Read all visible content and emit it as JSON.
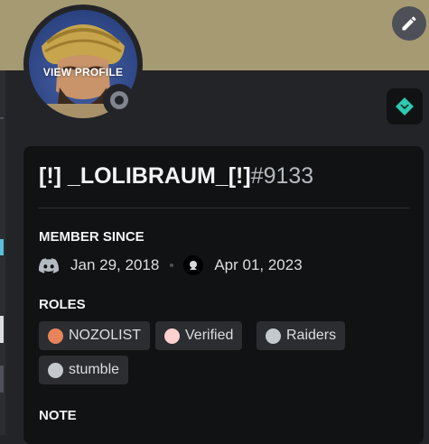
{
  "profile": {
    "avatar_overlay_label": "VIEW PROFILE",
    "username": "[!] _LOLIBRAUM_[!]",
    "discriminator": "#9133",
    "status": "offline"
  },
  "member_since": {
    "title": "MEMBER SINCE",
    "discord_date": "Jan 29, 2018",
    "server_date": "Apr 01, 2023"
  },
  "roles": {
    "title": "ROLES",
    "items": [
      {
        "name": "NOZOLIST",
        "color": "#e8845c"
      },
      {
        "name": "Verified",
        "color": "#ffd0d0"
      },
      {
        "name": "Raiders",
        "color": "#c4c9ce"
      },
      {
        "name": "stumble",
        "color": "#c4c9ce"
      }
    ]
  },
  "note": {
    "title": "NOTE"
  },
  "colors": {
    "banner": "#a59a72",
    "card_bg": "#111214",
    "badge_accent": "#2dc9b0"
  },
  "icons": [
    "edit-pencil-icon",
    "status-offline-icon",
    "hypesquad-badge-icon",
    "discord-logo-icon",
    "server-icon"
  ]
}
